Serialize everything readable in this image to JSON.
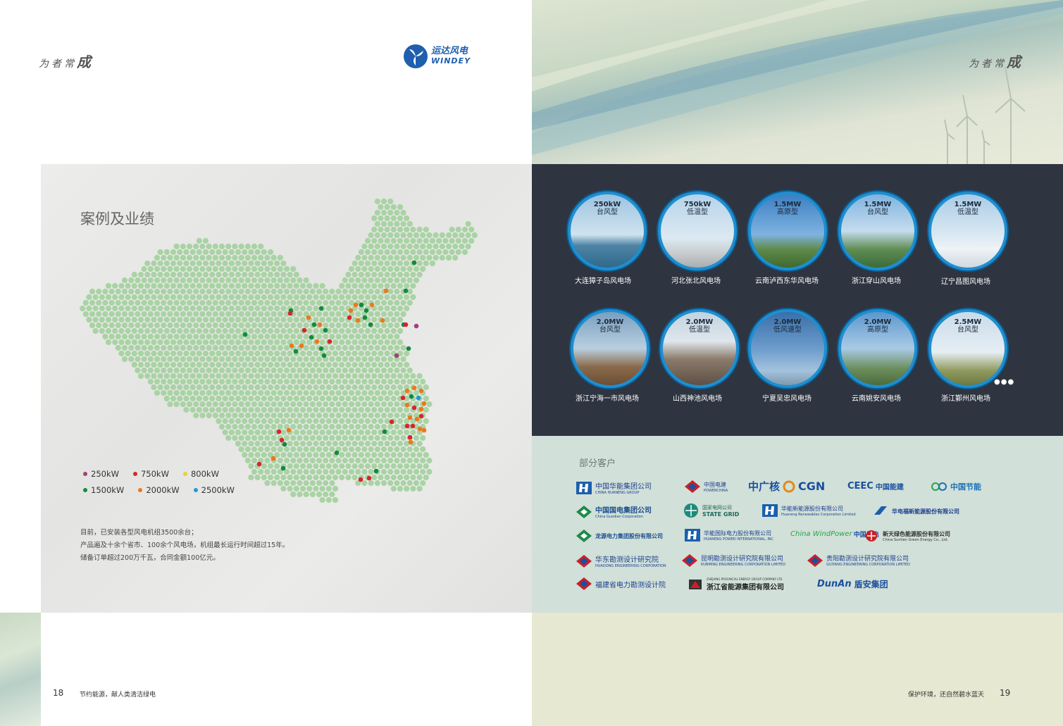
{
  "left_page": {
    "slogan_prefix": "为者常",
    "slogan_big": "成",
    "brand": {
      "cn": "运达风电",
      "en": "WINDEY"
    },
    "section_title": "案例及业绩",
    "legend": [
      {
        "label": "250kW",
        "color": "#a0427a"
      },
      {
        "label": "750kW",
        "color": "#d7262c"
      },
      {
        "label": "800kW",
        "color": "#e8d23a"
      },
      {
        "label": "1500kW",
        "color": "#148a3f"
      },
      {
        "label": "2000kW",
        "color": "#ea7a1e"
      },
      {
        "label": "2500kW",
        "color": "#1d9bd5"
      }
    ],
    "description": [
      "目前，已安装各型风电机组3500余台；",
      "产品遍及十余个省市、100余个风电场，机组最长运行时间超过15年。",
      "储备订单超过200万千瓦，合同金额100亿元。"
    ],
    "page_number": "18",
    "footer": "节约能源，献人类清洁绿电"
  },
  "right_page": {
    "slogan_prefix": "为者常",
    "slogan_big": "成",
    "wind_farms": [
      {
        "capacity": "250kW",
        "type": "台风型",
        "name": "大连獐子岛风电场"
      },
      {
        "capacity": "750kW",
        "type": "低温型",
        "name": "河北张北风电场"
      },
      {
        "capacity": "1.5MW",
        "type": "高原型",
        "name": "云南泸西东华风电场"
      },
      {
        "capacity": "1.5MW",
        "type": "台风型",
        "name": "浙江穿山风电场"
      },
      {
        "capacity": "1.5MW",
        "type": "低温型",
        "name": "辽宁昌图风电场"
      },
      {
        "capacity": "2.0MW",
        "type": "台风型",
        "name": "浙江宁海一市风电场"
      },
      {
        "capacity": "2.0MW",
        "type": "低温型",
        "name": "山西神池风电场"
      },
      {
        "capacity": "2.0MW",
        "type": "低风速型",
        "name": "宁夏吴忠风电场"
      },
      {
        "capacity": "2.0MW",
        "type": "高原型",
        "name": "云南姚安风电场"
      },
      {
        "capacity": "2.5MW",
        "type": "台风型",
        "name": "浙江鄞州风电场"
      }
    ],
    "more": "●●●",
    "clients_title": "部分客户",
    "clients": [
      {
        "cn": "中国华能集团公司",
        "en": "CHINA HUANENG GROUP"
      },
      {
        "cn": "中国电建",
        "en": "POWERCHINA"
      },
      {
        "cn": "中广核",
        "en": "CGN"
      },
      {
        "cn": "中国能建",
        "en": "CEEC"
      },
      {
        "cn": "中国节能",
        "en": ""
      },
      {
        "cn": "中国国电集团公司",
        "en": "China Guodian Corporation"
      },
      {
        "cn": "国家电网公司",
        "en": "STATE GRID"
      },
      {
        "cn": "华能新能源股份有限公司",
        "en": "Huaneng Renewables Corporation Limited"
      },
      {
        "cn": "华电福新能源股份有限公司",
        "en": ""
      },
      {
        "cn": "龙源电力集团股份有限公司",
        "en": ""
      },
      {
        "cn": "华能国际电力股份有限公司",
        "en": "HUANENG POWER INTERNATIONAL, INC"
      },
      {
        "cn": "中国风电",
        "en": "China WindPower"
      },
      {
        "cn": "新天绿色能源股份有限公司",
        "en": "China Suntien Green Energy Co., Ltd."
      },
      {
        "cn": "华东勘测设计研究院",
        "en": "HUADONG ENGINEERING CORPORATION"
      },
      {
        "cn": "昆明勘测设计研究院有限公司",
        "en": "KUNMING ENGINEERING CORPORATION LIMITED"
      },
      {
        "cn": "贵阳勘测设计研究院有限公司",
        "en": "GUIYANG ENGINEERING CORPORATION LIMITED"
      },
      {
        "cn": "福建省电力勘测设计院",
        "en": ""
      },
      {
        "cn": "浙江省能源集团有限公司",
        "en": "ZHEJIANG PROVINCIAL ENERGY GROUP COMPANY LTD"
      },
      {
        "cn": "盾安集团",
        "en": "DunAn"
      }
    ],
    "page_number": "19",
    "footer": "保护环境，还自然碧水蓝天"
  }
}
